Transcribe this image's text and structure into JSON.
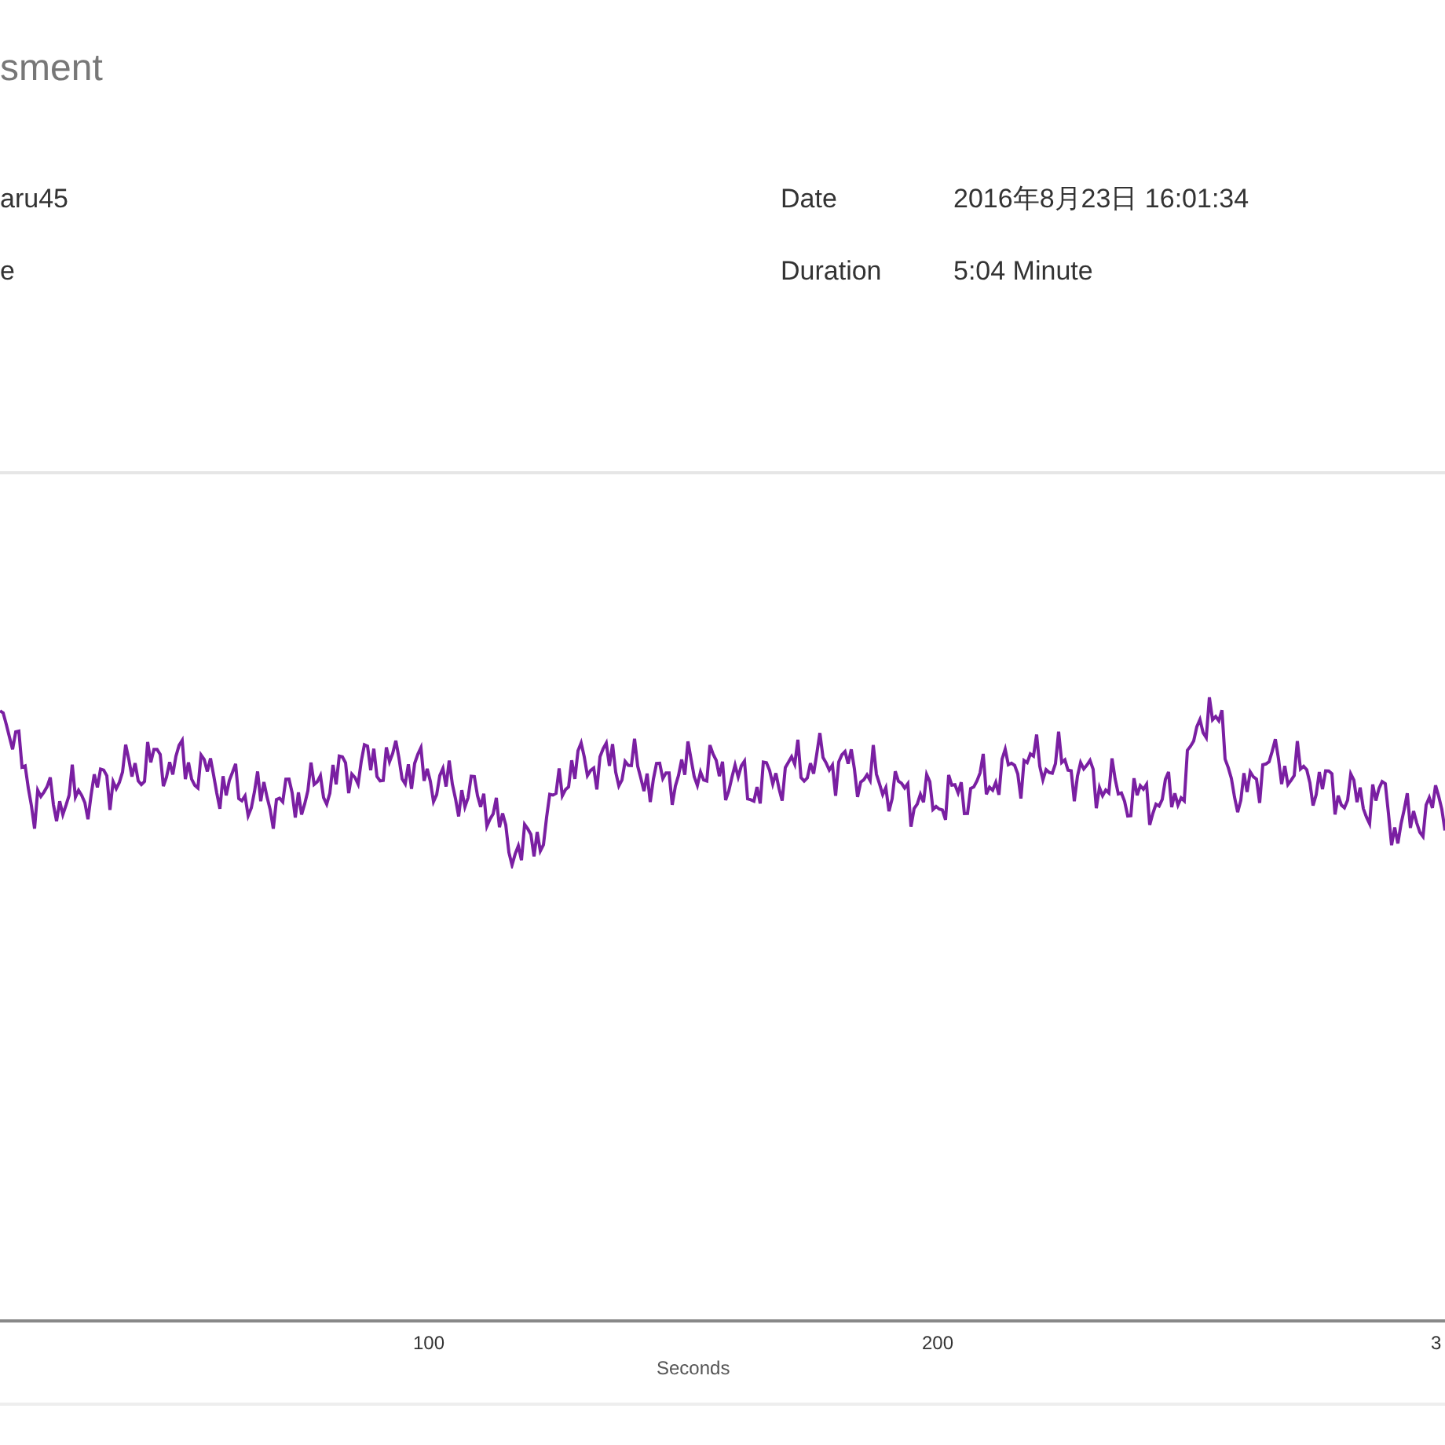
{
  "title": "sment",
  "details_left": [
    {
      "value": "aru45"
    },
    {
      "value": "e"
    }
  ],
  "details_right": [
    {
      "label": "Date",
      "value": "2016年8月23日 16:01:34"
    },
    {
      "label": "Duration",
      "value": "5:04 Minute"
    }
  ],
  "chart": {
    "x_ticks": [
      "100",
      "200",
      "3"
    ],
    "x_axis_title": "Seconds"
  }
}
